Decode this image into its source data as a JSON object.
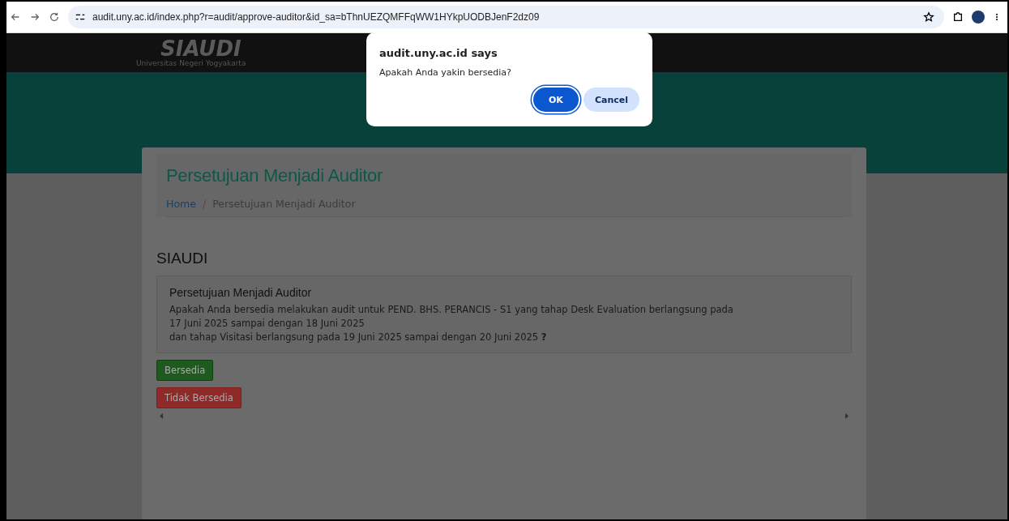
{
  "browser": {
    "url": "audit.uny.ac.id/index.php?r=audit/approve-auditor&id_sa=bThnUEZQMFFqWW1HYkpUODBJenF2dz09"
  },
  "header": {
    "logo_text": "SIAUDI",
    "logo_subtitle": "Universitas Negeri Yogyakarta"
  },
  "page": {
    "title": "Persetujuan Menjadi Auditor",
    "breadcrumb_separator": "/",
    "breadcrumb": [
      {
        "label": "Home",
        "link": true
      },
      {
        "label": "Persetujuan Menjadi Auditor",
        "link": false
      }
    ],
    "section_title": "SIAUDI",
    "panel": {
      "title": "Persetujuan Menjadi Auditor",
      "lines": [
        "Apakah Anda bersedia melakukan audit untuk PEND. BHS. PERANCIS - S1 yang tahap Desk Evaluation berlangsung pada",
        "17 Juni 2025 sampai dengan 18 Juni 2025",
        "dan tahap Visitasi berlangsung pada 19 Juni 2025 sampai dengan 20 Juni 2025 **?**"
      ]
    },
    "buttons": [
      {
        "label": "Bersedia",
        "kind": "success"
      },
      {
        "label": "Tidak Bersedia",
        "kind": "danger"
      }
    ]
  },
  "dialog": {
    "title": "audit.uny.ac.id says",
    "message": "Apakah Anda yakin bersedia?",
    "buttons": [
      {
        "label": "OK",
        "kind": "primary"
      },
      {
        "label": "Cancel",
        "kind": "secondary"
      }
    ]
  }
}
